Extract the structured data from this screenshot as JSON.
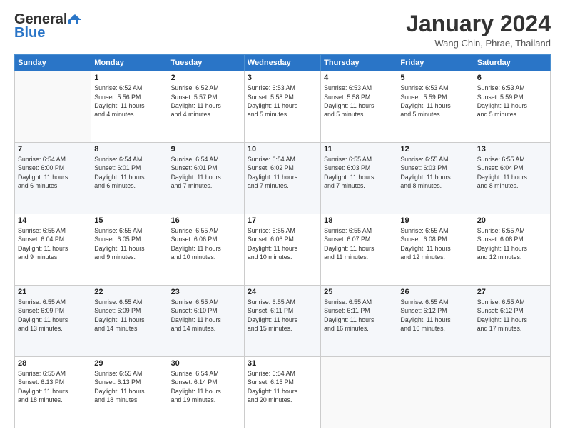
{
  "logo": {
    "general": "General",
    "blue": "Blue"
  },
  "title": "January 2024",
  "location": "Wang Chin, Phrae, Thailand",
  "days_header": [
    "Sunday",
    "Monday",
    "Tuesday",
    "Wednesday",
    "Thursday",
    "Friday",
    "Saturday"
  ],
  "weeks": [
    [
      {
        "day": "",
        "detail": ""
      },
      {
        "day": "1",
        "detail": "Sunrise: 6:52 AM\nSunset: 5:56 PM\nDaylight: 11 hours\nand 4 minutes."
      },
      {
        "day": "2",
        "detail": "Sunrise: 6:52 AM\nSunset: 5:57 PM\nDaylight: 11 hours\nand 4 minutes."
      },
      {
        "day": "3",
        "detail": "Sunrise: 6:53 AM\nSunset: 5:58 PM\nDaylight: 11 hours\nand 5 minutes."
      },
      {
        "day": "4",
        "detail": "Sunrise: 6:53 AM\nSunset: 5:58 PM\nDaylight: 11 hours\nand 5 minutes."
      },
      {
        "day": "5",
        "detail": "Sunrise: 6:53 AM\nSunset: 5:59 PM\nDaylight: 11 hours\nand 5 minutes."
      },
      {
        "day": "6",
        "detail": "Sunrise: 6:53 AM\nSunset: 5:59 PM\nDaylight: 11 hours\nand 5 minutes."
      }
    ],
    [
      {
        "day": "7",
        "detail": "Sunrise: 6:54 AM\nSunset: 6:00 PM\nDaylight: 11 hours\nand 6 minutes."
      },
      {
        "day": "8",
        "detail": "Sunrise: 6:54 AM\nSunset: 6:01 PM\nDaylight: 11 hours\nand 6 minutes."
      },
      {
        "day": "9",
        "detail": "Sunrise: 6:54 AM\nSunset: 6:01 PM\nDaylight: 11 hours\nand 7 minutes."
      },
      {
        "day": "10",
        "detail": "Sunrise: 6:54 AM\nSunset: 6:02 PM\nDaylight: 11 hours\nand 7 minutes."
      },
      {
        "day": "11",
        "detail": "Sunrise: 6:55 AM\nSunset: 6:03 PM\nDaylight: 11 hours\nand 7 minutes."
      },
      {
        "day": "12",
        "detail": "Sunrise: 6:55 AM\nSunset: 6:03 PM\nDaylight: 11 hours\nand 8 minutes."
      },
      {
        "day": "13",
        "detail": "Sunrise: 6:55 AM\nSunset: 6:04 PM\nDaylight: 11 hours\nand 8 minutes."
      }
    ],
    [
      {
        "day": "14",
        "detail": "Sunrise: 6:55 AM\nSunset: 6:04 PM\nDaylight: 11 hours\nand 9 minutes."
      },
      {
        "day": "15",
        "detail": "Sunrise: 6:55 AM\nSunset: 6:05 PM\nDaylight: 11 hours\nand 9 minutes."
      },
      {
        "day": "16",
        "detail": "Sunrise: 6:55 AM\nSunset: 6:06 PM\nDaylight: 11 hours\nand 10 minutes."
      },
      {
        "day": "17",
        "detail": "Sunrise: 6:55 AM\nSunset: 6:06 PM\nDaylight: 11 hours\nand 10 minutes."
      },
      {
        "day": "18",
        "detail": "Sunrise: 6:55 AM\nSunset: 6:07 PM\nDaylight: 11 hours\nand 11 minutes."
      },
      {
        "day": "19",
        "detail": "Sunrise: 6:55 AM\nSunset: 6:08 PM\nDaylight: 11 hours\nand 12 minutes."
      },
      {
        "day": "20",
        "detail": "Sunrise: 6:55 AM\nSunset: 6:08 PM\nDaylight: 11 hours\nand 12 minutes."
      }
    ],
    [
      {
        "day": "21",
        "detail": "Sunrise: 6:55 AM\nSunset: 6:09 PM\nDaylight: 11 hours\nand 13 minutes."
      },
      {
        "day": "22",
        "detail": "Sunrise: 6:55 AM\nSunset: 6:09 PM\nDaylight: 11 hours\nand 14 minutes."
      },
      {
        "day": "23",
        "detail": "Sunrise: 6:55 AM\nSunset: 6:10 PM\nDaylight: 11 hours\nand 14 minutes."
      },
      {
        "day": "24",
        "detail": "Sunrise: 6:55 AM\nSunset: 6:11 PM\nDaylight: 11 hours\nand 15 minutes."
      },
      {
        "day": "25",
        "detail": "Sunrise: 6:55 AM\nSunset: 6:11 PM\nDaylight: 11 hours\nand 16 minutes."
      },
      {
        "day": "26",
        "detail": "Sunrise: 6:55 AM\nSunset: 6:12 PM\nDaylight: 11 hours\nand 16 minutes."
      },
      {
        "day": "27",
        "detail": "Sunrise: 6:55 AM\nSunset: 6:12 PM\nDaylight: 11 hours\nand 17 minutes."
      }
    ],
    [
      {
        "day": "28",
        "detail": "Sunrise: 6:55 AM\nSunset: 6:13 PM\nDaylight: 11 hours\nand 18 minutes."
      },
      {
        "day": "29",
        "detail": "Sunrise: 6:55 AM\nSunset: 6:13 PM\nDaylight: 11 hours\nand 18 minutes."
      },
      {
        "day": "30",
        "detail": "Sunrise: 6:54 AM\nSunset: 6:14 PM\nDaylight: 11 hours\nand 19 minutes."
      },
      {
        "day": "31",
        "detail": "Sunrise: 6:54 AM\nSunset: 6:15 PM\nDaylight: 11 hours\nand 20 minutes."
      },
      {
        "day": "",
        "detail": ""
      },
      {
        "day": "",
        "detail": ""
      },
      {
        "day": "",
        "detail": ""
      }
    ]
  ]
}
